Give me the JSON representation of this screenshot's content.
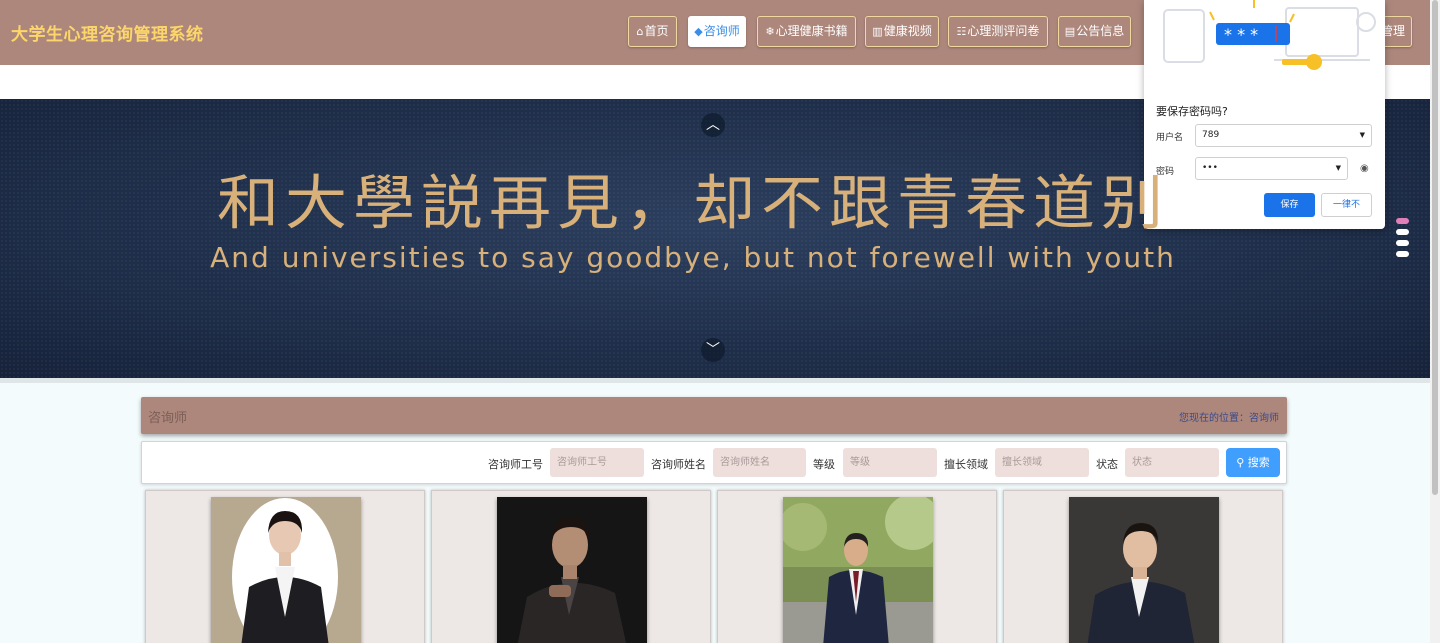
{
  "header": {
    "site_title": "大学生心理咨询管理系统",
    "nav": [
      {
        "icon": "home-icon",
        "glyph": "⌂",
        "label": "首页"
      },
      {
        "icon": "cap-icon",
        "glyph": "🎓",
        "label": "咨询师"
      },
      {
        "icon": "snowflake-icon",
        "glyph": "❄",
        "label": "心理健康书籍"
      },
      {
        "icon": "book-icon",
        "glyph": "📖",
        "label": "健康视频"
      },
      {
        "icon": "survey-icon",
        "glyph": "☷",
        "label": "心理测评问卷"
      },
      {
        "icon": "notice-icon",
        "glyph": "▤",
        "label": "公告信息"
      }
    ],
    "nav_partial_label": "管理"
  },
  "banner": {
    "title_cn": "和大學説再見，却不跟青春道别",
    "title_en": "And universities to say goodbye, but not forewell with youth"
  },
  "breadcrumb": {
    "title": "咨询师",
    "location": "您现在的位置：咨询师"
  },
  "search": {
    "fields": [
      {
        "label": "咨询师工号",
        "placeholder": "咨询师工号"
      },
      {
        "label": "咨询师姓名",
        "placeholder": "咨询师姓名"
      },
      {
        "label": "等级",
        "placeholder": "等级"
      },
      {
        "label": "擅长领域",
        "placeholder": "擅长领域"
      },
      {
        "label": "状态",
        "placeholder": "状态"
      }
    ],
    "button_label": "搜索"
  },
  "password_popup": {
    "question": "要保存密码吗?",
    "username_label": "用户名",
    "username_value": "789",
    "password_label": "密码",
    "password_value": "•••",
    "save_label": "保存",
    "never_label": "一律不"
  }
}
